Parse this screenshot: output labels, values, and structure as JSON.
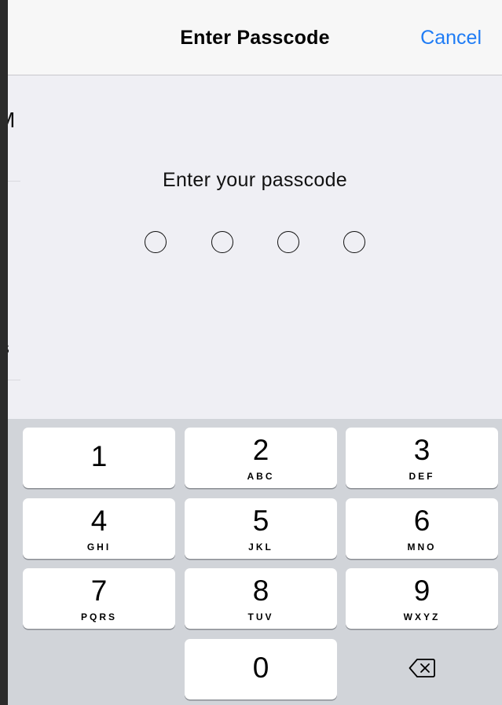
{
  "navbar": {
    "title": "Enter Passcode",
    "cancel_label": "Cancel"
  },
  "background": {
    "fragment_1": "M",
    "fragment_2": "ls"
  },
  "prompt": "Enter your passcode",
  "passcode": {
    "length": 4,
    "entered": 0
  },
  "keypad": {
    "keys": [
      {
        "digit": "1",
        "letters": ""
      },
      {
        "digit": "2",
        "letters": "ABC"
      },
      {
        "digit": "3",
        "letters": "DEF"
      },
      {
        "digit": "4",
        "letters": "GHI"
      },
      {
        "digit": "5",
        "letters": "JKL"
      },
      {
        "digit": "6",
        "letters": "MNO"
      },
      {
        "digit": "7",
        "letters": "PQRS"
      },
      {
        "digit": "8",
        "letters": "TUV"
      },
      {
        "digit": "9",
        "letters": "WXYZ"
      },
      {
        "digit": "0",
        "letters": ""
      }
    ],
    "delete_icon": "backspace-icon"
  },
  "colors": {
    "accent": "#1f7cf5",
    "background": "#efeff4",
    "keypad_background": "#d1d4d9"
  }
}
